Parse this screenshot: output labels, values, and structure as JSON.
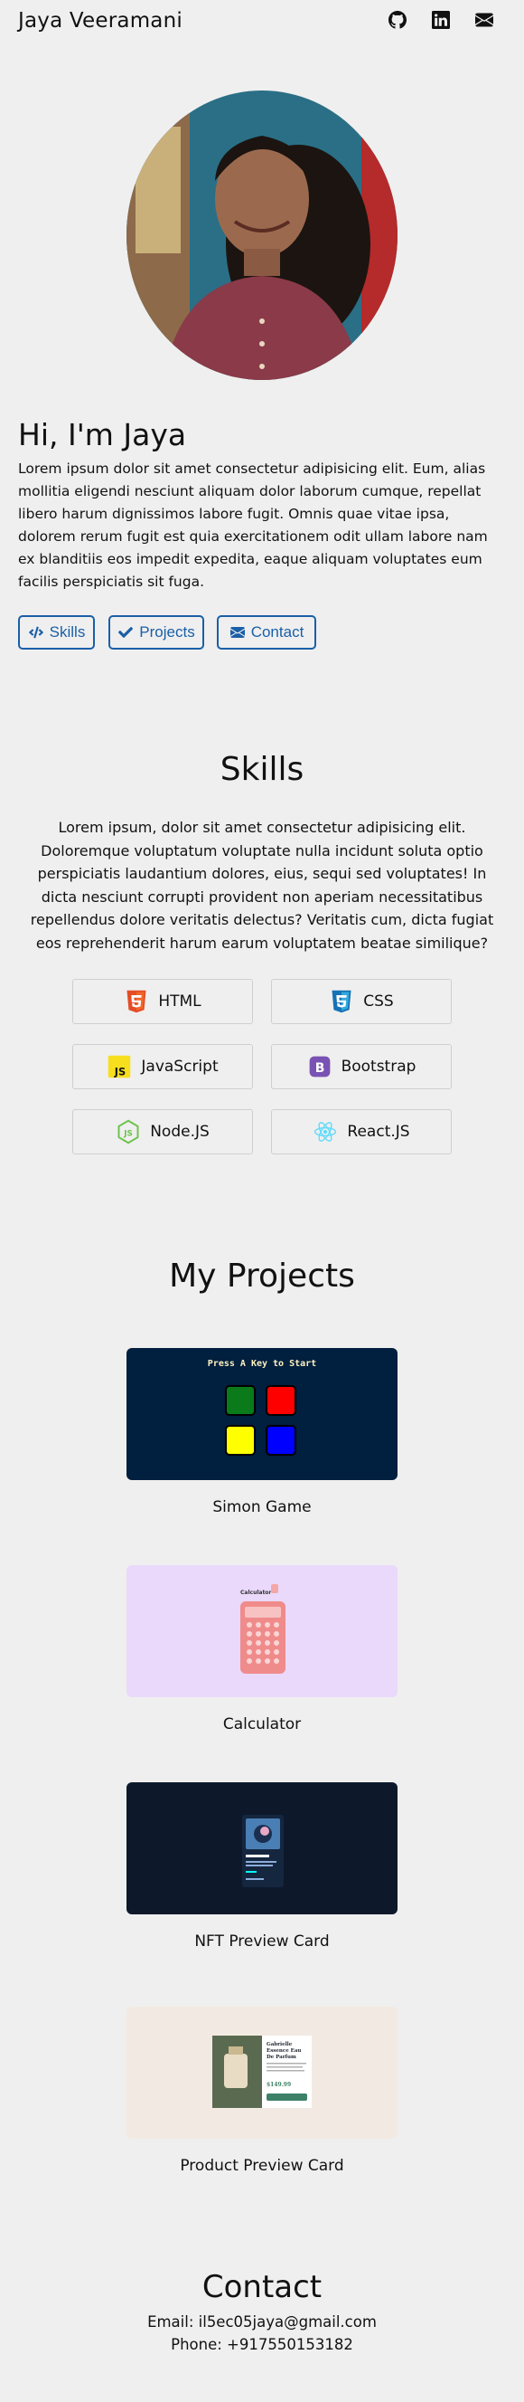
{
  "header": {
    "name": "Jaya Veeramani",
    "social": [
      {
        "icon": "github-icon"
      },
      {
        "icon": "linkedin-icon"
      },
      {
        "icon": "envelope-icon"
      }
    ]
  },
  "hero": {
    "title": "Hi, I'm Jaya",
    "text": "Lorem ipsum dolor sit amet consectetur adipisicing elit. Eum, alias mollitia eligendi nesciunt aliquam dolor laborum cumque, repellat libero harum dignissimos labore fugit. Omnis quae vitae ipsa, dolorem rerum fugit est quia exercitationem odit ullam labore nam ex blanditiis eos impedit expedita, eaque aliquam voluptates eum facilis perspiciatis sit fuga.",
    "buttons": [
      {
        "label": "Skills",
        "icon": "code-icon"
      },
      {
        "label": "Projects",
        "icon": "check-icon"
      },
      {
        "label": "Contact",
        "icon": "envelope-icon"
      }
    ]
  },
  "skills": {
    "title": "Skills",
    "text": "Lorem ipsum, dolor sit amet consectetur adipisicing elit. Doloremque voluptatum voluptate nulla incidunt soluta optio perspiciatis laudantium dolores, eius, sequi sed voluptates! In dicta nesciunt corrupti provident non aperiam necessitatibus repellendus dolore veritatis delectus? Veritatis cum, dicta fugiat eos reprehenderit harum earum voluptatem beatae similique?",
    "items": [
      {
        "label": "HTML",
        "icon": "html5-icon",
        "color": "#e44d26"
      },
      {
        "label": "CSS",
        "icon": "css3-icon",
        "color": "#1572b6"
      },
      {
        "label": "JavaScript",
        "icon": "javascript-icon",
        "color": "#f7df1e"
      },
      {
        "label": "Bootstrap",
        "icon": "bootstrap-icon",
        "color": "#7952b3"
      },
      {
        "label": "Node.JS",
        "icon": "nodejs-icon",
        "color": "#6cc24a"
      },
      {
        "label": "React.JS",
        "icon": "react-icon",
        "color": "#61dafb"
      }
    ]
  },
  "projects": {
    "title": "My Projects",
    "items": [
      {
        "caption": "Simon Game",
        "thumb_text": "Press A Key to Start"
      },
      {
        "caption": "Calculator",
        "thumb_text": "Calculator"
      },
      {
        "caption": "NFT Preview Card"
      },
      {
        "caption": "Product Preview Card",
        "thumb_text": "Gabrielle Essence Eau De Parfum",
        "price": "$149.99"
      }
    ]
  },
  "contact": {
    "title": "Contact",
    "email": "Email: il5ec05jaya@gmail.com",
    "phone": "Phone: +917550153182"
  },
  "colors": {
    "background": "#efefef",
    "accent": "#1a5fa8"
  }
}
